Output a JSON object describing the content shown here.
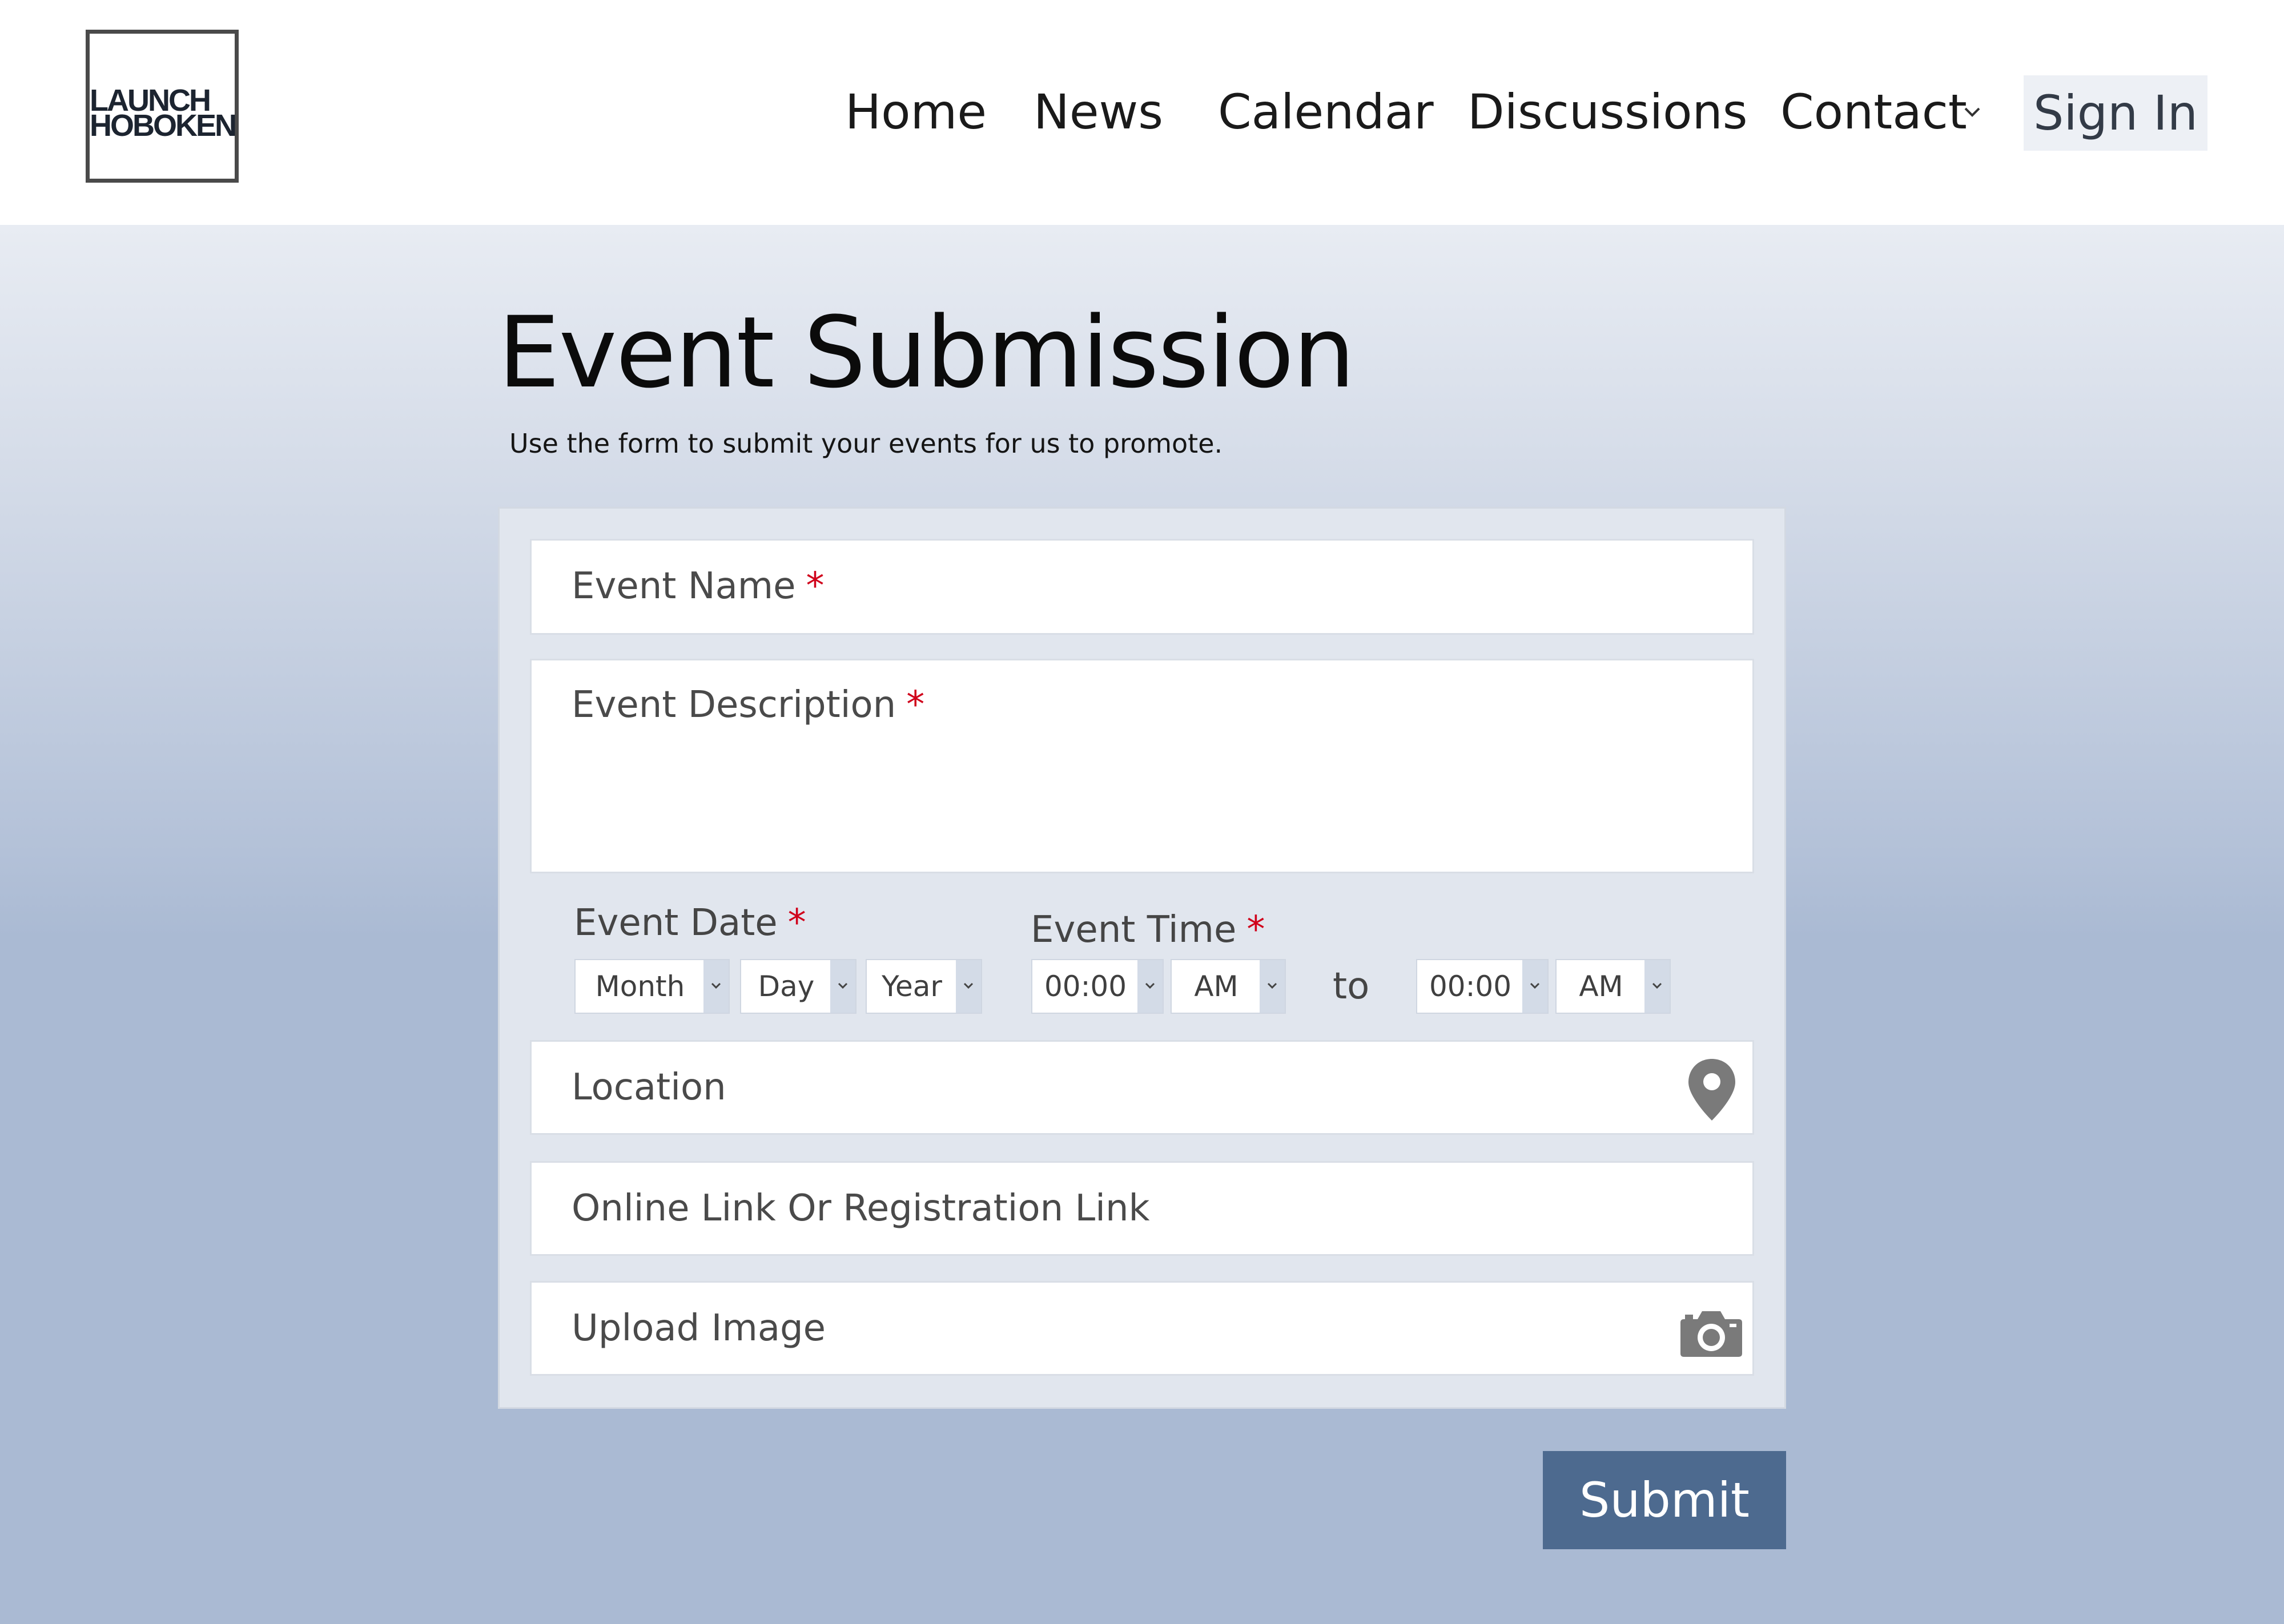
{
  "logo": {
    "line1": "LAUNCH",
    "line2": "HOBOKEN"
  },
  "nav": {
    "items": [
      {
        "label": "Home"
      },
      {
        "label": "News"
      },
      {
        "label": "Calendar"
      },
      {
        "label": "Discussions"
      },
      {
        "label": "Contact"
      }
    ],
    "sign_in": "Sign In"
  },
  "page": {
    "title": "Event Submission",
    "subtitle": "Use the form to submit your events for us to promote."
  },
  "form": {
    "required_marker": "*",
    "event_name": {
      "label": "Event Name"
    },
    "event_description": {
      "label": "Event Description"
    },
    "event_date": {
      "label": "Event Date",
      "month": "Month",
      "day": "Day",
      "year": "Year"
    },
    "event_time": {
      "label": "Event Time",
      "start_time": "00:00",
      "start_ampm": "AM",
      "to_label": "to",
      "end_time": "00:00",
      "end_ampm": "AM"
    },
    "location": {
      "label": "Location",
      "icon": "map-pin-icon"
    },
    "online_link": {
      "label": "Online Link Or Registration Link"
    },
    "upload_image": {
      "label": "Upload Image",
      "icon": "camera-icon"
    },
    "submit_label": "Submit"
  },
  "colors": {
    "required": "#d0021b",
    "submit_bg": "#4d6a8f",
    "page_bg": "#aabad3",
    "panel_bg": "#e1e6ee"
  }
}
